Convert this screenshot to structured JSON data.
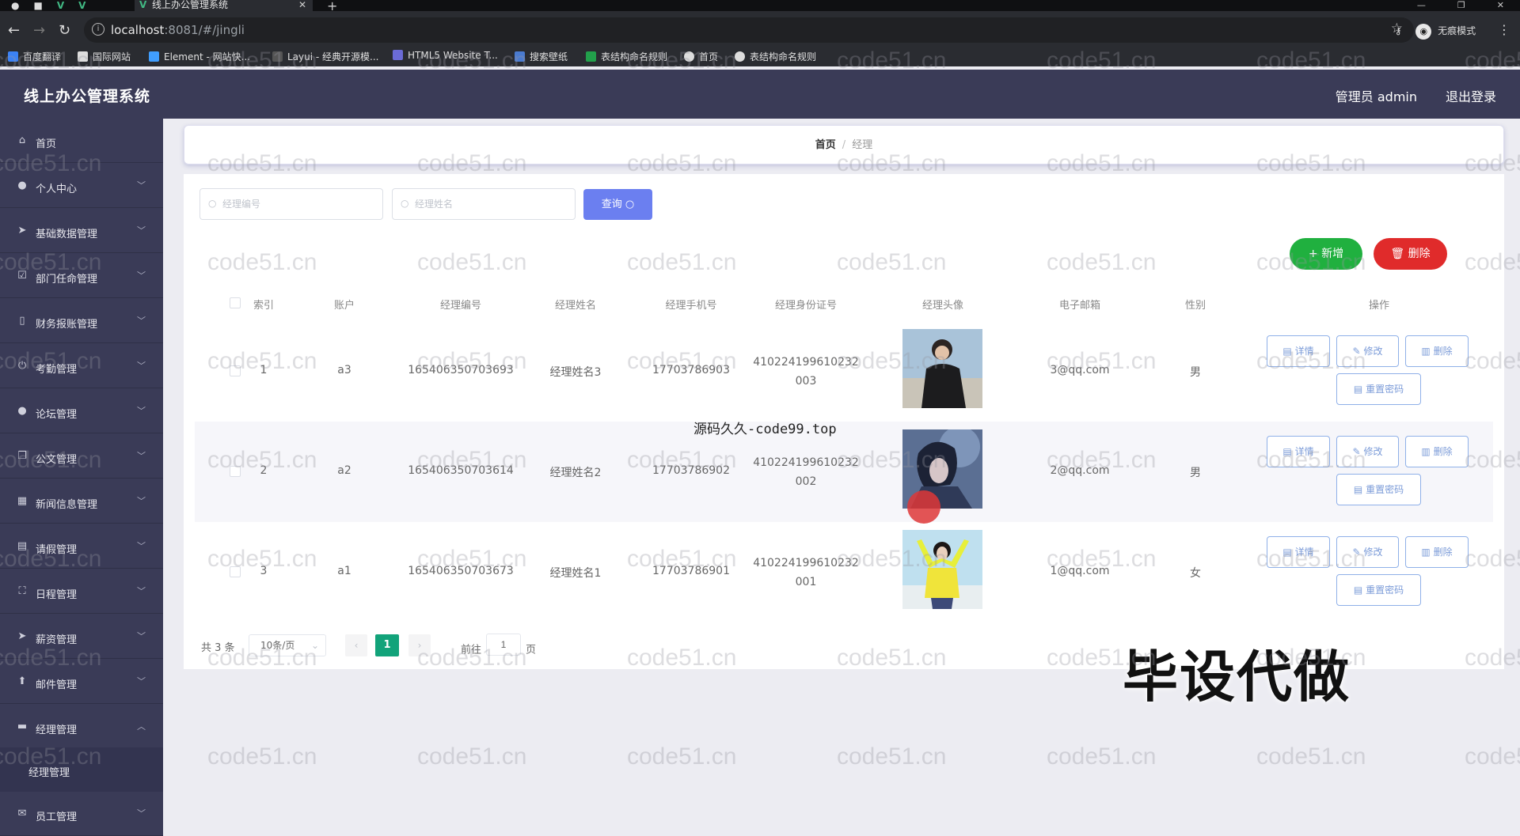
{
  "browser": {
    "tab_title": "线上办公管理系统",
    "url_host": "localhost",
    "url_path": ":8081/#/jingli",
    "profile_label": "无痕模式",
    "bookmarks": [
      "百度翻译",
      "国际网站",
      "Element - 网站快...",
      "Layui - 经典开源模...",
      "HTML5 Website T...",
      "搜索壁纸",
      "表结构命名规则",
      "首页",
      "表结构命名规则"
    ]
  },
  "header": {
    "title": "线上办公管理系统",
    "user": "管理员 admin",
    "logout": "退出登录"
  },
  "sidebar": {
    "items": [
      {
        "label": "首页",
        "icon": "home-icon"
      },
      {
        "label": "个人中心",
        "icon": "user-icon"
      },
      {
        "label": "基础数据管理",
        "icon": "send-icon"
      },
      {
        "label": "部门任命管理",
        "icon": "checkbox-icon"
      },
      {
        "label": "财务报账管理",
        "icon": "phone-icon"
      },
      {
        "label": "考勤管理",
        "icon": "power-icon"
      },
      {
        "label": "论坛管理",
        "icon": "user-icon"
      },
      {
        "label": "公文管理",
        "icon": "copy-icon"
      },
      {
        "label": "新闻信息管理",
        "icon": "grid-icon"
      },
      {
        "label": "请假管理",
        "icon": "trash-icon"
      },
      {
        "label": "日程管理",
        "icon": "frame-icon"
      },
      {
        "label": "薪资管理",
        "icon": "send-icon"
      },
      {
        "label": "邮件管理",
        "icon": "upload-icon"
      },
      {
        "label": "经理管理",
        "icon": "chat-icon"
      },
      {
        "label": "员工管理",
        "icon": "mail-icon"
      }
    ],
    "submenu_label": "经理管理"
  },
  "breadcrumb": {
    "home": "首页",
    "sep": "/",
    "current": "经理"
  },
  "search": {
    "manager_no_placeholder": "经理编号",
    "manager_name_placeholder": "经理姓名",
    "query_label": "查询"
  },
  "actions": {
    "add_label": "新增",
    "delete_label": "删除"
  },
  "table": {
    "columns": [
      "索引",
      "账户",
      "经理编号",
      "经理姓名",
      "经理手机号",
      "经理身份证号",
      "经理头像",
      "电子邮箱",
      "性别",
      "操作"
    ],
    "rows": [
      {
        "index": "1",
        "account": "a3",
        "no": "165406350703693",
        "name": "经理姓名3",
        "phone": "17703786903",
        "id_line1": "410224199610232",
        "id_line2": "003",
        "email": "3@qq.com",
        "gender": "男"
      },
      {
        "index": "2",
        "account": "a2",
        "no": "165406350703614",
        "name": "经理姓名2",
        "phone": "17703786902",
        "id_line1": "410224199610232",
        "id_line2": "002",
        "email": "2@qq.com",
        "gender": "男"
      },
      {
        "index": "3",
        "account": "a1",
        "no": "165406350703673",
        "name": "经理姓名1",
        "phone": "17703786901",
        "id_line1": "410224199610232",
        "id_line2": "001",
        "email": "1@qq.com",
        "gender": "女"
      }
    ],
    "op_labels": {
      "detail": "详情",
      "edit": "修改",
      "delete": "删除",
      "reset": "重置密码"
    }
  },
  "pagination": {
    "total": "共 3 条",
    "page_size": "10条/页",
    "current_page": "1",
    "goto_prefix": "前往",
    "goto_value": "1",
    "goto_suffix": "页"
  },
  "overlays": {
    "site_text": "源码久久-code99.top",
    "promo_text": "毕设代做",
    "watermark": "code51.cn"
  },
  "colors": {
    "header_bg": "#3a3b57",
    "query_btn": "#6b7ff0",
    "add_btn": "#20b03f",
    "delete_btn": "#e02b2b",
    "page_active": "#12a37a"
  }
}
